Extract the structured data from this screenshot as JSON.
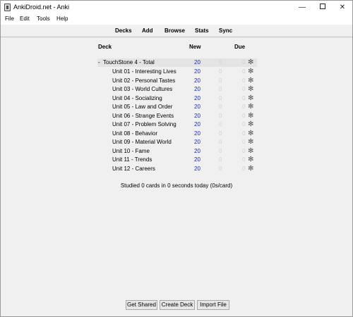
{
  "window": {
    "title": "AnkiDroid.net - Anki",
    "minimize_glyph": "—",
    "close_glyph": "✕"
  },
  "menubar": {
    "items": [
      {
        "label": "File"
      },
      {
        "label": "Edit"
      },
      {
        "label": "Tools"
      },
      {
        "label": "Help"
      }
    ]
  },
  "toolbar": {
    "links": [
      {
        "label": "Decks"
      },
      {
        "label": "Add"
      },
      {
        "label": "Browse"
      },
      {
        "label": "Stats"
      },
      {
        "label": "Sync"
      }
    ]
  },
  "deck_list": {
    "headers": {
      "deck": "Deck",
      "new": "New",
      "due": "Due"
    },
    "collapse_glyph": "-",
    "gear_glyph": "✻",
    "rows": [
      {
        "name": "TouchStone 4 - Total",
        "new": "20",
        "learn": "0",
        "due": "0"
      },
      {
        "name": "Unit 01 - Interesting Lives",
        "new": "20",
        "learn": "0",
        "due": "0"
      },
      {
        "name": "Unit 02 - Personal Tastes",
        "new": "20",
        "learn": "0",
        "due": "0"
      },
      {
        "name": "Unit 03 - World Cultures",
        "new": "20",
        "learn": "0",
        "due": "0"
      },
      {
        "name": "Unit 04 - Socializing",
        "new": "20",
        "learn": "0",
        "due": "0"
      },
      {
        "name": "Unit 05 - Law and Order",
        "new": "20",
        "learn": "0",
        "due": "0"
      },
      {
        "name": "Unit 06 - Strange Events",
        "new": "20",
        "learn": "0",
        "due": "0"
      },
      {
        "name": "Unit 07 - Problem Solving",
        "new": "20",
        "learn": "0",
        "due": "0"
      },
      {
        "name": "Unit 08 - Behavior",
        "new": "20",
        "learn": "0",
        "due": "0"
      },
      {
        "name": "Unit 09 - Material World",
        "new": "20",
        "learn": "0",
        "due": "0"
      },
      {
        "name": "Unit 10 - Fame",
        "new": "20",
        "learn": "0",
        "due": "0"
      },
      {
        "name": "Unit 11 - Trends",
        "new": "20",
        "learn": "0",
        "due": "0"
      },
      {
        "name": "Unit 12 - Careers",
        "new": "20",
        "learn": "0",
        "due": "0"
      }
    ]
  },
  "studied_text": "Studied 0 cards in 0 seconds today (0s/card)",
  "bottom_buttons": {
    "get_shared": "Get Shared",
    "create_deck": "Create Deck",
    "import_file": "Import File"
  },
  "colors": {
    "new_count": "#1c2aa6",
    "zero_count": "#cfcfcf",
    "background": "#f0f0f0"
  }
}
